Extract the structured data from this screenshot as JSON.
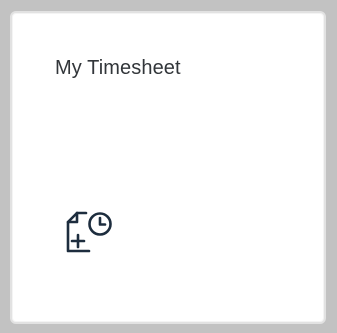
{
  "tile": {
    "title": "My Timesheet",
    "icon": "timesheet-add-clock-icon",
    "colors": {
      "background": "#c2c2c2",
      "tile": "#ffffff",
      "border": "#e2e2e2",
      "text": "#32363a",
      "icon": "#1d2d3e"
    }
  }
}
